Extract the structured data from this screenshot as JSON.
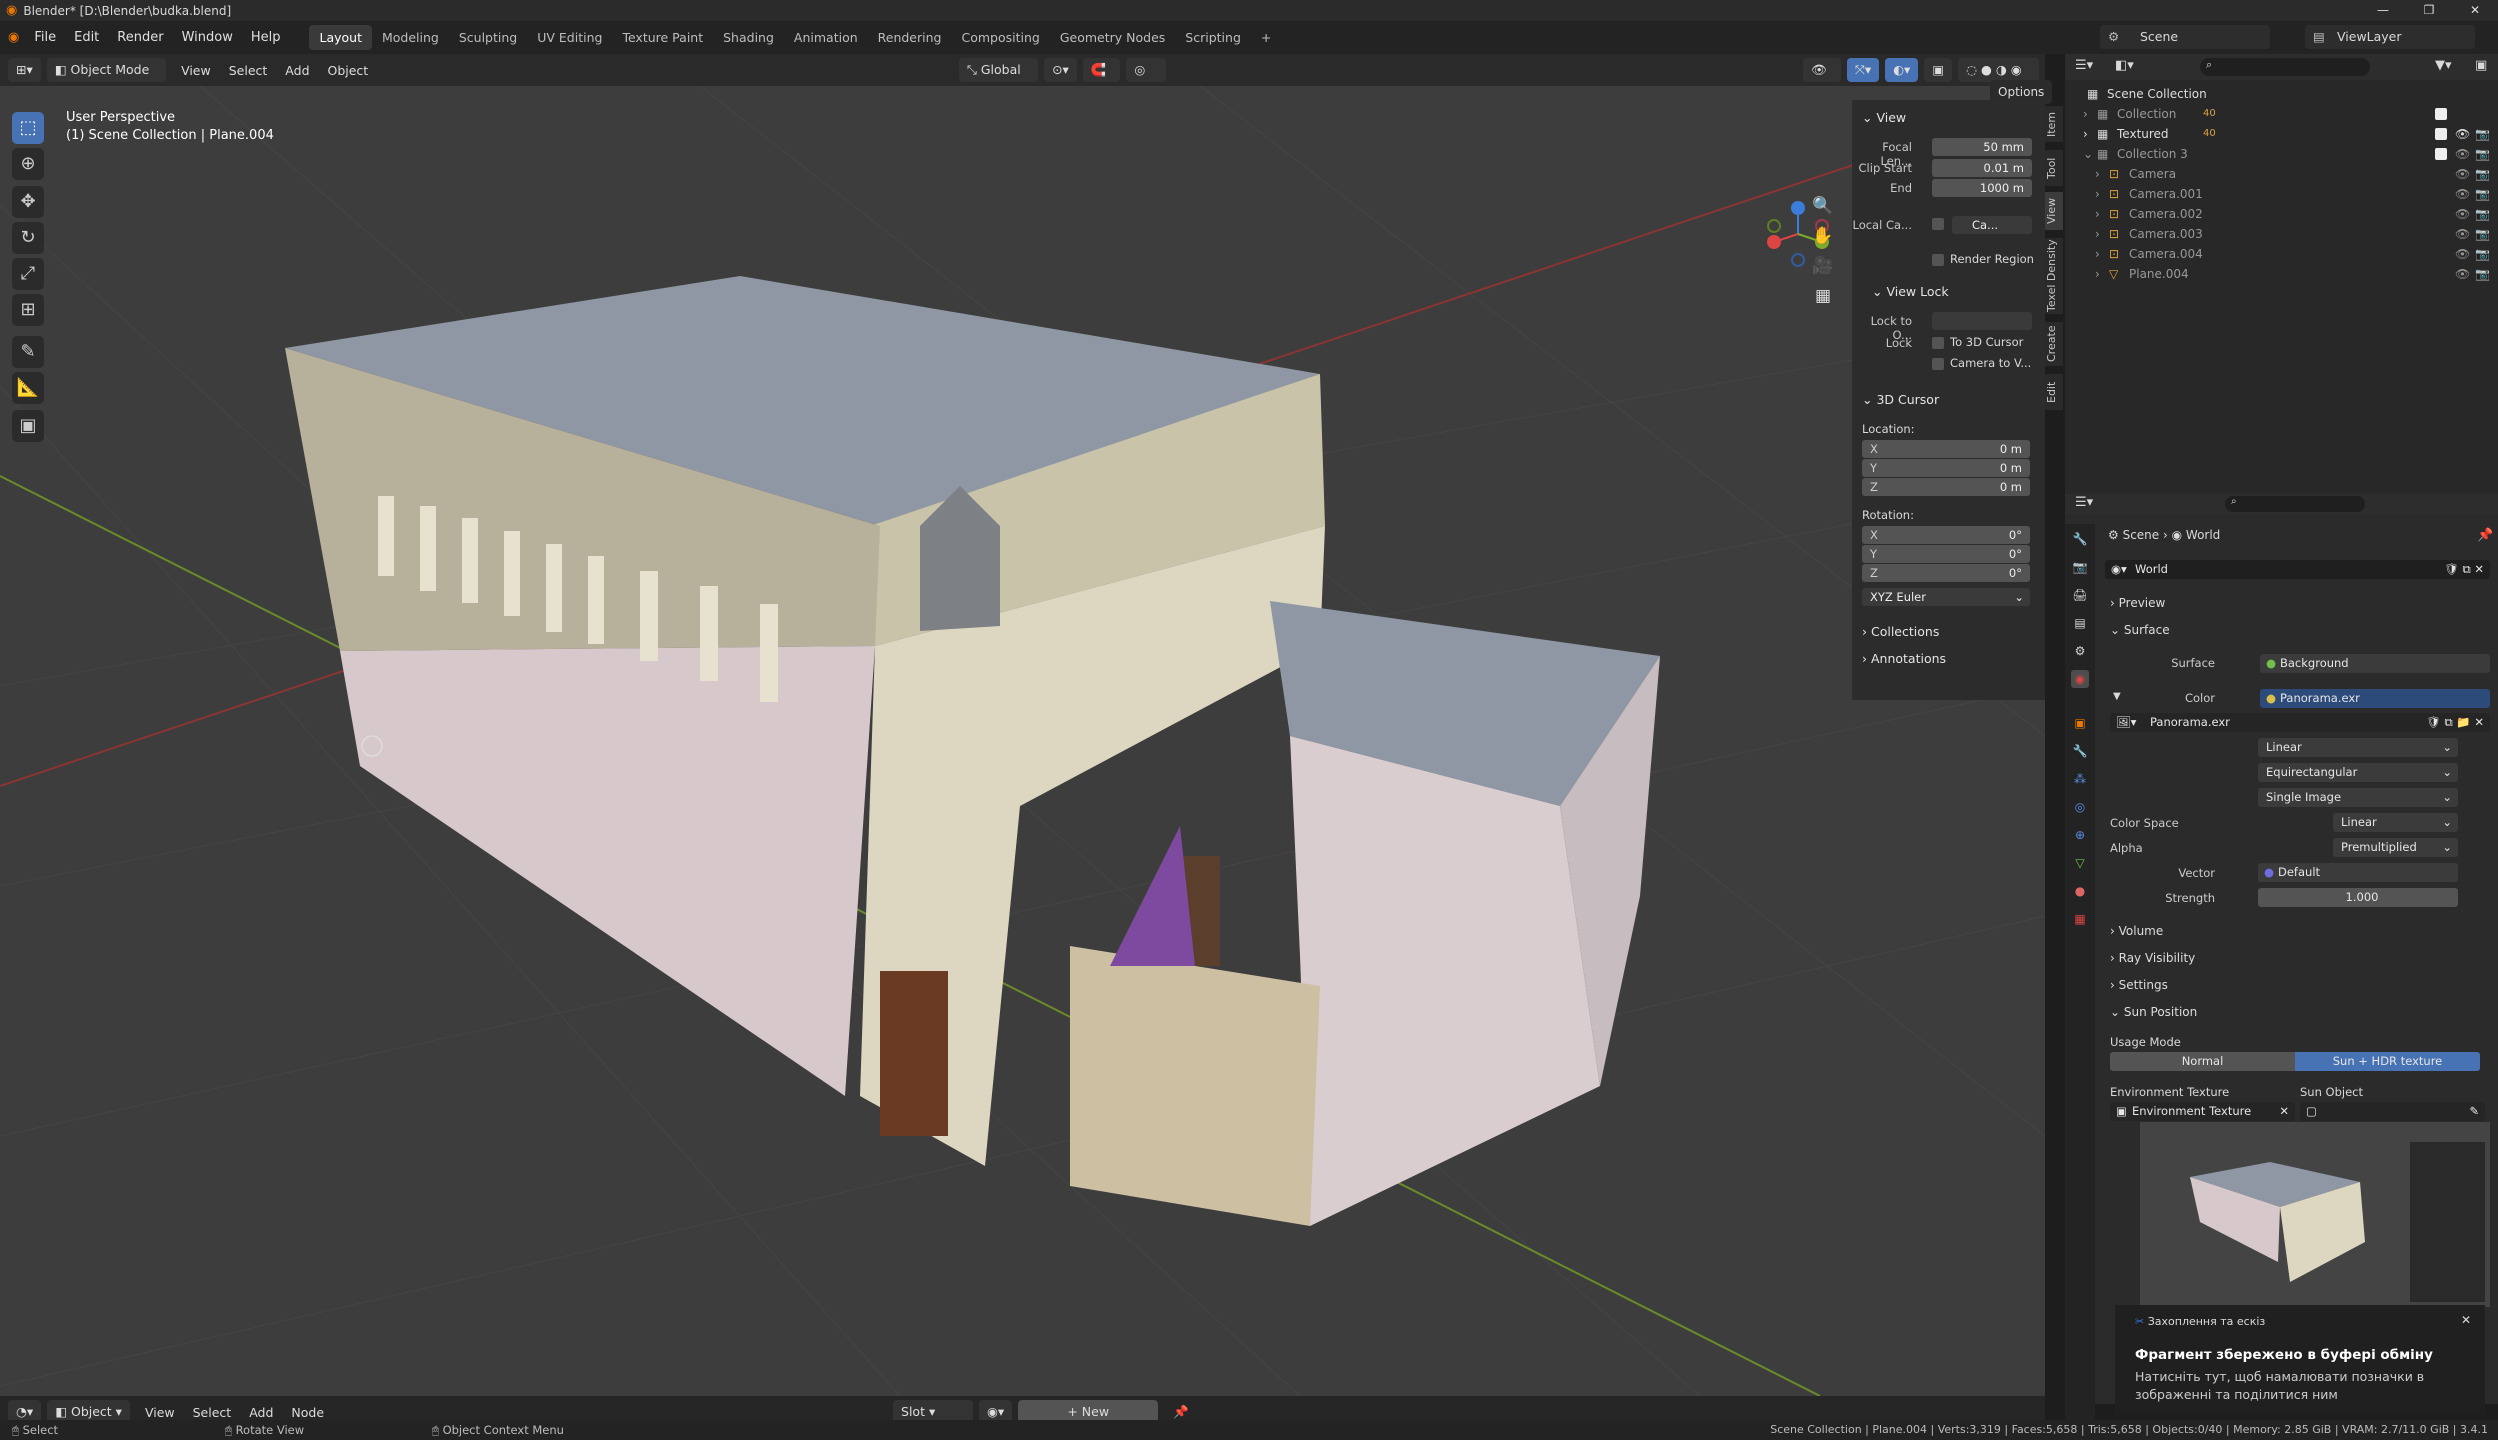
{
  "titlebar": {
    "title": "Blender* [D:\\Blender\\budka.blend]",
    "minimize": "—",
    "maximize": "❐",
    "close": "✕"
  },
  "menu": {
    "file": "File",
    "edit": "Edit",
    "render": "Render",
    "window": "Window",
    "help": "Help"
  },
  "workspaces": [
    "Layout",
    "Modeling",
    "Sculpting",
    "UV Editing",
    "Texture Paint",
    "Shading",
    "Animation",
    "Rendering",
    "Compositing",
    "Geometry Nodes",
    "Scripting",
    "+"
  ],
  "scene_selector": {
    "label": "Scene"
  },
  "viewlayer_selector": {
    "label": "ViewLayer"
  },
  "vp_header": {
    "mode": "Object Mode",
    "view": "View",
    "select": "Select",
    "add": "Add",
    "object": "Object",
    "orientation": "Global",
    "options": "Options"
  },
  "viewport": {
    "perspective": "User Perspective",
    "context": "(1) Scene Collection | Plane.004"
  },
  "npanel": {
    "view_title": "View",
    "focal_label": "Focal Len...",
    "focal": "50 mm",
    "clip_start_label": "Clip Start",
    "clip_start": "0.01 m",
    "end_label": "End",
    "end": "1000 m",
    "local_cam_label": "Local Ca...",
    "local_cam_val": "Ca...",
    "render_region": "Render Region",
    "viewlock_title": "View Lock",
    "lock_to_label": "Lock to O...",
    "lock_label": "Lock",
    "to_cursor": "To 3D Cursor",
    "cam_to_view": "Camera to V...",
    "cursor_title": "3D Cursor",
    "location_label": "Location:",
    "loc_x_label": "X",
    "loc_x": "0 m",
    "loc_y_label": "Y",
    "loc_y": "0 m",
    "loc_z_label": "Z",
    "loc_z": "0 m",
    "rotation_label": "Rotation:",
    "rot_x_label": "X",
    "rot_x": "0°",
    "rot_y_label": "Y",
    "rot_y": "0°",
    "rot_z_label": "Z",
    "rot_z": "0°",
    "rot_mode": "XYZ Euler",
    "collections": "Collections",
    "annotations": "Annotations"
  },
  "npanel_tabs": [
    "Item",
    "Tool",
    "View",
    "Texel Density",
    "Create",
    "Edit"
  ],
  "outliner": {
    "rows": [
      {
        "label": "Scene Collection",
        "count": ""
      },
      {
        "label": "Collection",
        "count": "40"
      },
      {
        "label": "Textured",
        "count": "40"
      },
      {
        "label": "Collection 3",
        "count": ""
      },
      {
        "label": "Camera",
        "count": ""
      },
      {
        "label": "Camera.001",
        "count": ""
      },
      {
        "label": "Camera.002",
        "count": ""
      },
      {
        "label": "Camera.003",
        "count": ""
      },
      {
        "label": "Camera.004",
        "count": ""
      },
      {
        "label": "Plane.004",
        "count": ""
      }
    ]
  },
  "props": {
    "breadcrumb_scene": "Scene",
    "breadcrumb_world": "World",
    "world_name": "World",
    "preview": "Preview",
    "surface_section": "Surface",
    "surface_label": "Surface",
    "surface_val": "Background",
    "color_label": "Color",
    "color_val": "Panorama.exr",
    "image_name": "Panorama.exr",
    "interp": "Linear",
    "projection": "Equirectangular",
    "source": "Single Image",
    "colorspace_label": "Color Space",
    "colorspace": "Linear",
    "alpha_label": "Alpha",
    "alpha": "Premultiplied",
    "vector_label": "Vector",
    "vector": "Default",
    "strength_label": "Strength",
    "strength": "1.000",
    "volume": "Volume",
    "ray_visibility": "Ray Visibility",
    "settings": "Settings",
    "sun_position": "Sun Position",
    "usage_mode_label": "Usage Mode",
    "usage_normal": "Normal",
    "usage_sun_hdr": "Sun + HDR texture",
    "env_tex_label": "Environment Texture",
    "sun_object_label": "Sun Object",
    "env_tex_val": "Environment Texture"
  },
  "notification": {
    "app": "Захоплення та ескіз",
    "title": "Фрагмент збережено в буфері обміну",
    "body": "Натисніть тут, щоб намалювати позначки в зображенні та поділитися ним",
    "close": "✕"
  },
  "bottom_hdr": {
    "mode": "Object",
    "view": "View",
    "select": "Select",
    "add": "Add",
    "node": "Node",
    "slot": "Slot",
    "new": "New"
  },
  "statusbar": {
    "select": "Select",
    "rotate": "Rotate View",
    "context_menu": "Object Context Menu",
    "stats": "Scene Collection | Plane.004 | Verts:3,319 | Faces:5,658 | Tris:5,658 | Objects:0/40 | Memory: 2.85 GiB | VRAM: 2.7/11.0 GiB | 3.4.1"
  },
  "colors": {
    "accent": "#4772b3",
    "selected_blue": "#2c4a7a",
    "blender_orange": "#ea7600"
  }
}
